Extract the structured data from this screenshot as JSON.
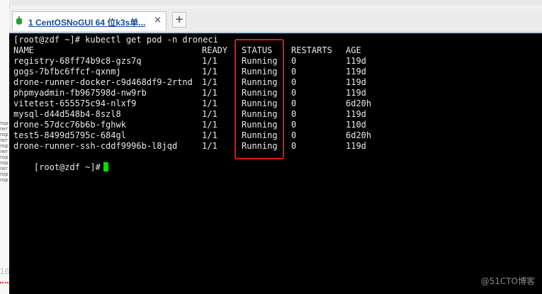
{
  "window": {
    "tab_label": "1 CentOSNoGUI 64 位k3s单...",
    "tab_close": "×",
    "new_tab": "+"
  },
  "left_strip": {
    "fragments": [
      "nsp",
      "ner",
      "nsp",
      "ner",
      "nsp",
      "ner",
      "nsp",
      "nsp",
      "ner",
      "nsp",
      "nsp"
    ],
    "number": "16"
  },
  "terminal": {
    "command_line": "[root@zdf ~]# kubectl get pod -n droneci",
    "headers": {
      "name": "NAME",
      "ready": "READY",
      "status": "STATUS",
      "restarts": "RESTARTS",
      "age": "AGE"
    },
    "rows": [
      {
        "name": "registry-68ff74b9c8-gzs7q",
        "ready": "1/1",
        "status": "Running",
        "restarts": "0",
        "age": "119d"
      },
      {
        "name": "gogs-7bfbc6ffcf-qxnmj",
        "ready": "1/1",
        "status": "Running",
        "restarts": "0",
        "age": "119d"
      },
      {
        "name": "drone-runner-docker-c9d468df9-2rtnd",
        "ready": "1/1",
        "status": "Running",
        "restarts": "0",
        "age": "119d"
      },
      {
        "name": "phpmyadmin-fb967598d-nw9rb",
        "ready": "1/1",
        "status": "Running",
        "restarts": "0",
        "age": "119d"
      },
      {
        "name": "vitetest-655575c94-nlxf9",
        "ready": "1/1",
        "status": "Running",
        "restarts": "0",
        "age": "6d20h"
      },
      {
        "name": "mysql-d44d548b4-8szl8",
        "ready": "1/1",
        "status": "Running",
        "restarts": "0",
        "age": "119d"
      },
      {
        "name": "drone-57dcc76b6b-fghwk",
        "ready": "1/1",
        "status": "Running",
        "restarts": "0",
        "age": "110d"
      },
      {
        "name": "test5-8499d5795c-684gl",
        "ready": "1/1",
        "status": "Running",
        "restarts": "0",
        "age": "6d20h"
      },
      {
        "name": "drone-runner-ssh-cddf9996b-l8jqd",
        "ready": "1/1",
        "status": "Running",
        "restarts": "0",
        "age": "119d"
      }
    ],
    "prompt": "[root@zdf ~]#"
  },
  "watermark": "@51CTO博客",
  "colors": {
    "terminal_bg": "#000000",
    "terminal_fg": "#e8e8e8",
    "cursor": "#00e000",
    "highlight": "#e01818",
    "tab_text": "#1a4c9e",
    "status_dot": "#1fa12b"
  }
}
